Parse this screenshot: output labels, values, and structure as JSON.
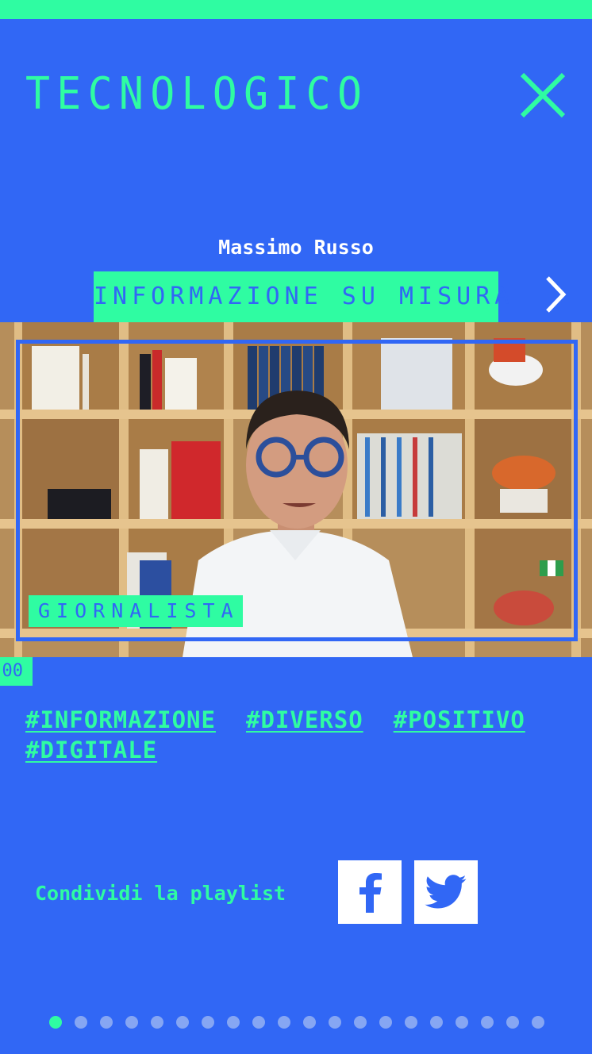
{
  "header": {
    "title": "TECNOLOGICO",
    "close_icon": "close-x-icon"
  },
  "video": {
    "author": "Massimo Russo",
    "title": "INFORMAZIONE SU MISURA",
    "role": "GIORNALISTA",
    "progress_text": "00",
    "next_icon": "chevron-right-icon"
  },
  "hashtags": [
    "#INFORMAZIONE",
    "#DIVERSO",
    "#POSITIVO",
    "#DIGITALE"
  ],
  "share": {
    "label": "Condividi la playlist",
    "facebook_icon": "facebook-icon",
    "twitter_icon": "twitter-icon"
  },
  "pagination": {
    "total": 20,
    "active_index": 0
  },
  "colors": {
    "background": "#3167f5",
    "accent": "#2ffca2",
    "white": "#ffffff"
  }
}
